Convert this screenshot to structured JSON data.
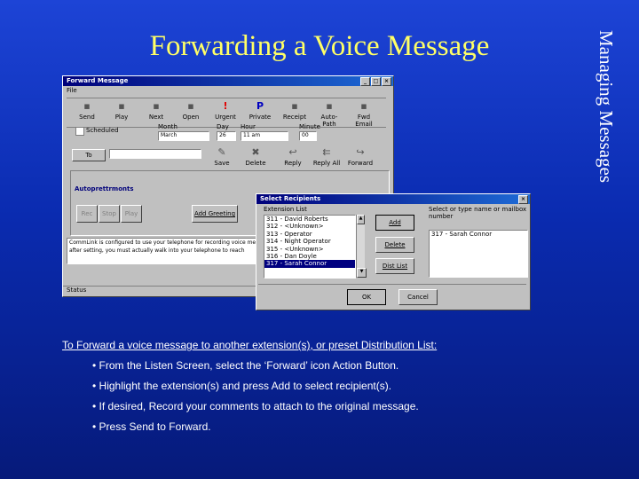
{
  "slide": {
    "title": "Forwarding a Voice Message",
    "side_title": "Managing Messages",
    "instruction": "To Forward a voice message to another extension(s), or preset Distribution List:",
    "bullets": [
      "From the Listen Screen, select the ‘Forward’ icon Action Button.",
      "Highlight the extension(s) and press Add to select recipient(s).",
      "If desired, Record your comments to attach to the original message.",
      "Press Send to Forward."
    ]
  },
  "forward_window": {
    "title": "Forward Message",
    "menu": "File",
    "toolbar": [
      {
        "label": "Send",
        "icon": "send-icon"
      },
      {
        "label": "Play",
        "icon": "play-icon"
      },
      {
        "label": "Next",
        "icon": "next-icon"
      },
      {
        "label": "Open",
        "icon": "open-icon"
      },
      {
        "label": "Urgent",
        "icon": "urgent-icon",
        "glyph": "!"
      },
      {
        "label": "Private",
        "icon": "private-icon",
        "glyph": "P"
      },
      {
        "label": "Receipt",
        "icon": "receipt-icon"
      },
      {
        "label": "Auto-Path",
        "icon": "auto-path-icon"
      },
      {
        "label": "Fwd Email",
        "icon": "forward-email-icon"
      }
    ],
    "scheduled_label": "Scheduled",
    "month_label": "Month",
    "month_value": "March",
    "day_label": "Day",
    "day_value": "26",
    "hour_label": "Hour",
    "hour_value": "11 am",
    "minute_label": "Minute",
    "minute_value": "00",
    "save_label": "Save",
    "delete_label": "Delete",
    "reply_label": "Reply",
    "reply_all_label": "Reply All",
    "forward_label": "Forward",
    "prompt_label": "Autoprettrmonts",
    "rec_label": "Rec",
    "stop_label": "Stop",
    "play_label": "Play",
    "add_greeting_label": "Add Greeting",
    "note_line1": "CommLink is configured to use your telephone for recording voice mess",
    "note_line2": "after setting, you must actually walk into your telephone to reach",
    "status_label": "Status"
  },
  "recipients_dialog": {
    "title": "Select Recipients",
    "ext_list_label": "Extension List",
    "select_label": "Select or type name or mailbox number",
    "extensions": [
      "311 - David Roberts",
      "312 - <Unknown>",
      "313 - Operator",
      "314 - Night Operator",
      "315 - <Unknown>",
      "316 - Dan Doyle",
      "317 - Sarah Connor"
    ],
    "selected_index": 6,
    "add_label": "Add",
    "delete_label": "Delete",
    "dist_list_label": "Dist List",
    "recipients": [
      "317 - Sarah Connor"
    ],
    "ok_label": "OK",
    "cancel_label": "Cancel"
  }
}
